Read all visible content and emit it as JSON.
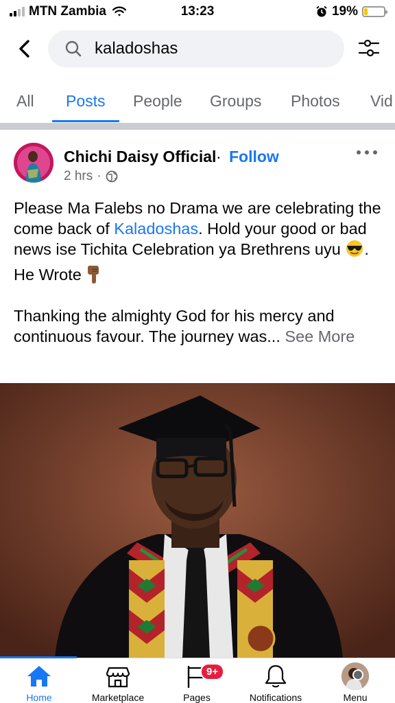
{
  "status_bar": {
    "carrier": "MTN Zambia",
    "time": "13:23",
    "battery": "19%",
    "battery_level": 0.19,
    "icons": [
      "signal-icon",
      "wifi-icon",
      "alarm-icon",
      "battery-icon"
    ]
  },
  "search": {
    "query": "kaladoshas",
    "icons": [
      "back-icon",
      "search-icon",
      "filter-icon"
    ]
  },
  "tabs": [
    "All",
    "Posts",
    "People",
    "Groups",
    "Photos",
    "Vid"
  ],
  "active_tab": "Posts",
  "post": {
    "author": "Chichi Daisy Official",
    "separator": "·",
    "follow": "Follow",
    "time": "2 hrs",
    "dot": "·",
    "text_1a": "Please Ma Falebs no Drama we are celebrating the come back of ",
    "text_1_link": "Kaladoshas",
    "text_1b": ". Hold your good or bad news ise Tichita Celebration ya Brethrens uyu ",
    "text_1c": ".",
    "text_2": "He Wrote",
    "text_3": "Thanking the almighty God for his mercy and continuous favour. The journey was...",
    "see_more": "See More",
    "icons": [
      "globe-icon",
      "more-icon",
      "sunglasses-emoji-icon",
      "pointing-down-emoji-icon"
    ]
  },
  "bottom_nav": {
    "items": [
      {
        "label": "Home",
        "icon": "home-icon"
      },
      {
        "label": "Marketplace",
        "icon": "marketplace-icon"
      },
      {
        "label": "Pages",
        "icon": "pages-icon"
      },
      {
        "label": "Notifications",
        "icon": "bell-icon"
      },
      {
        "label": "Menu",
        "icon": "menu-avatar-icon"
      }
    ],
    "pages_badge": "9+"
  },
  "colors": {
    "accent": "#1877f2",
    "badge": "#e41e3f",
    "secondary_text": "#65676b"
  }
}
